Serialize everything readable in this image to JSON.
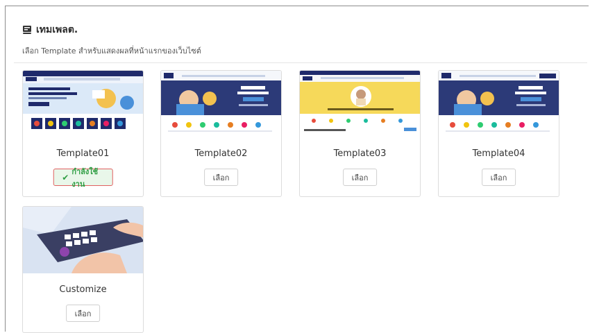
{
  "header": {
    "title": "เทมเพลต.",
    "subtitle": "เลือก Template สำหรับแสดงผลที่หน้าแรกของเว็บไซต์"
  },
  "templates": [
    {
      "name": "Template01",
      "button": "กำลังใช้งาน",
      "active": true
    },
    {
      "name": "Template02",
      "button": "เลือก",
      "active": false
    },
    {
      "name": "Template03",
      "button": "เลือก",
      "active": false
    },
    {
      "name": "Template04",
      "button": "เลือก",
      "active": false
    },
    {
      "name": "Customize",
      "button": "เลือก",
      "active": false
    }
  ],
  "colors": {
    "navy": "#1f2a6b",
    "accent_yellow": "#f6d95a",
    "active_green": "#2f9e44",
    "active_border": "#e06060"
  },
  "icons": [
    "template-icon",
    "check-icon"
  ]
}
